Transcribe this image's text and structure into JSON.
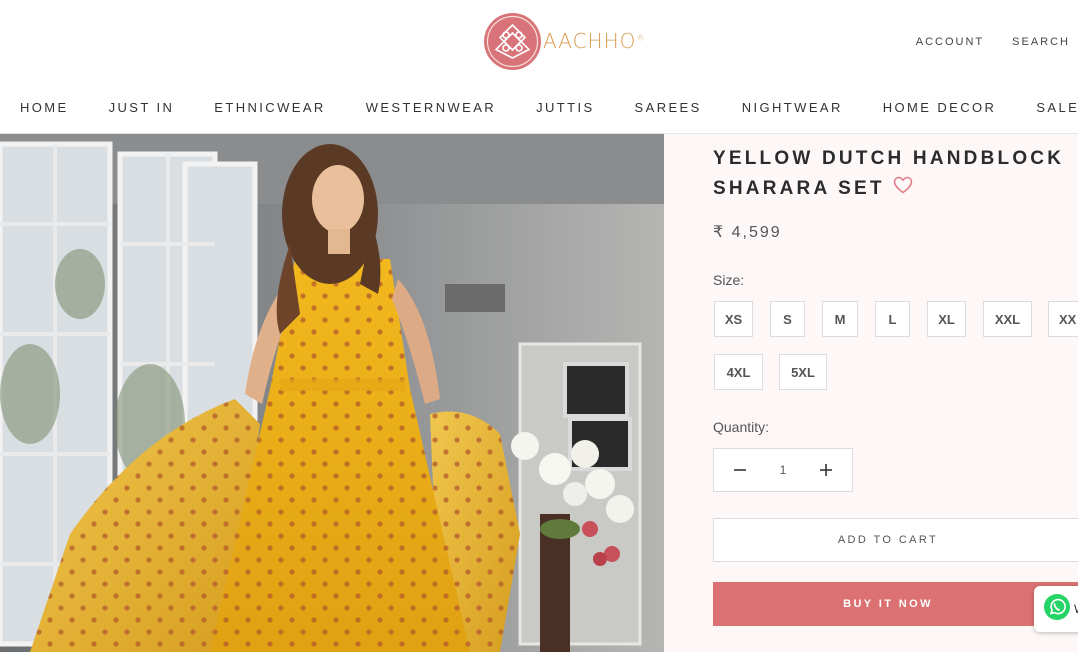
{
  "brand": {
    "name": "AACHHO",
    "trademark": "®",
    "colors": {
      "accent": "#dc7173",
      "logo_circle": "#d8737a",
      "logo_text": "#d99a4e",
      "panel_bg": "#fdf7f7"
    }
  },
  "header": {
    "account_label": "ACCOUNT",
    "search_label": "SEARCH"
  },
  "nav": {
    "items": [
      "HOME",
      "JUST IN",
      "ETHNICWEAR",
      "WESTERNWEAR",
      "JUTTIS",
      "SAREES",
      "NIGHTWEAR",
      "HOME DECOR",
      "SALE"
    ]
  },
  "product": {
    "title_line1": "YELLOW DUTCH HANDBLOCK",
    "title_line2": "SHARARA SET",
    "price": "₹ 4,599",
    "size_label": "Size:",
    "sizes": [
      "XS",
      "S",
      "M",
      "L",
      "XL",
      "XXL",
      "XX",
      "4XL",
      "5XL"
    ],
    "quantity_label": "Quantity:",
    "quantity_value": "1",
    "add_to_cart_label": "ADD TO CART",
    "buy_now_label": "BUY IT NOW",
    "wishlist_icon": "heart-outline-icon"
  },
  "whatsapp": {
    "icon": "whatsapp-icon",
    "label": "W"
  }
}
